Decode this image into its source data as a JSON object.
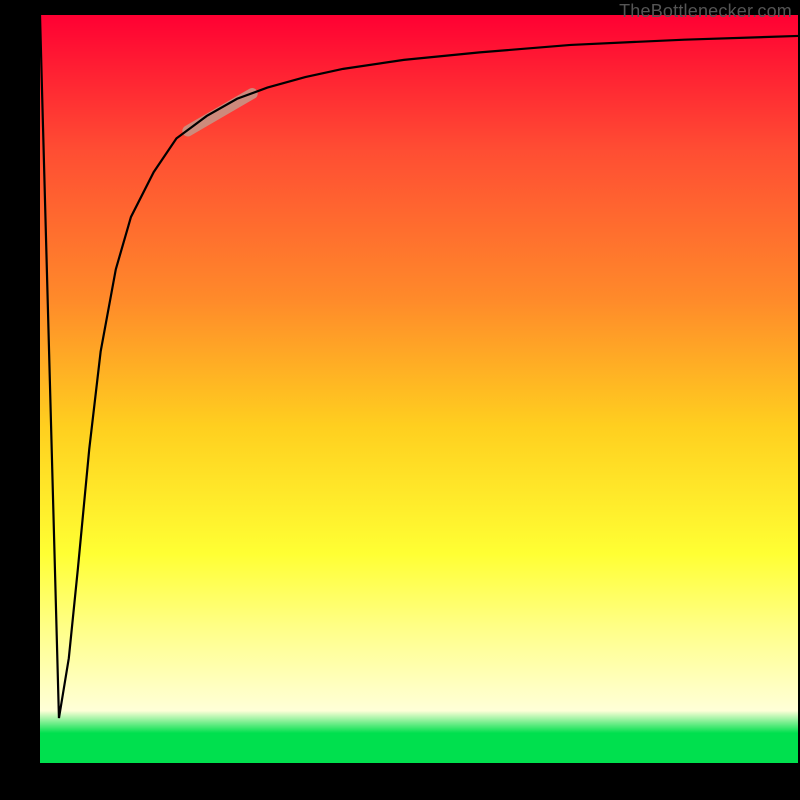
{
  "attribution_text": "TheBottlenecker.com",
  "chart_data": {
    "type": "line",
    "title": "",
    "xlabel": "",
    "ylabel": "",
    "xlim": [
      0,
      100
    ],
    "ylim": [
      0,
      100
    ],
    "series": [
      {
        "name": "curve",
        "x": [
          0,
          2.5,
          3.8,
          5.0,
          6.5,
          8.0,
          10,
          12,
          15,
          18,
          22,
          26,
          30,
          35,
          40,
          48,
          58,
          70,
          85,
          100
        ],
        "y": [
          100,
          6,
          14,
          26,
          42,
          55,
          66,
          73,
          79,
          83.5,
          86.5,
          88.8,
          90.3,
          91.7,
          92.8,
          94,
          95,
          96,
          96.7,
          97.2
        ]
      }
    ],
    "highlight_segment": {
      "x": [
        19.5,
        28
      ],
      "y": [
        84.5,
        89.5
      ]
    },
    "background_gradient_stops": [
      {
        "offset": 0,
        "color": "#ff0033"
      },
      {
        "offset": 18,
        "color": "#ff4d33"
      },
      {
        "offset": 38,
        "color": "#ff8a2a"
      },
      {
        "offset": 55,
        "color": "#ffcf1f"
      },
      {
        "offset": 72,
        "color": "#ffff33"
      },
      {
        "offset": 82,
        "color": "#ffff88"
      },
      {
        "offset": 89,
        "color": "#ffffbb"
      },
      {
        "offset": 93,
        "color": "#ffffd8"
      },
      {
        "offset": 96,
        "color": "#00e04e"
      },
      {
        "offset": 100,
        "color": "#00e04e"
      }
    ]
  }
}
